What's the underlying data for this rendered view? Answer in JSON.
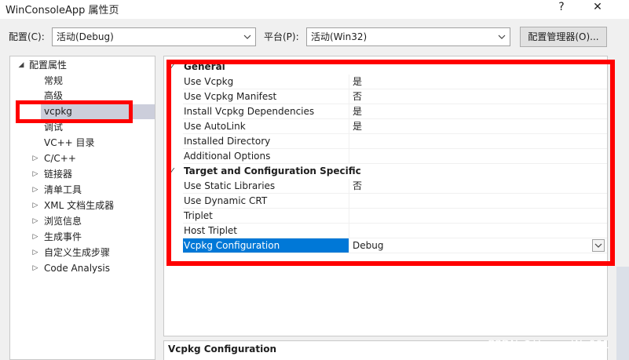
{
  "window": {
    "title": "WinConsoleApp 属性页",
    "help_label": "?",
    "close_label": "✕"
  },
  "toolbar": {
    "config_label": "配置(C):",
    "config_value": "活动(Debug)",
    "platform_label": "平台(P):",
    "platform_value": "活动(Win32)",
    "manager_button": "配置管理器(O)..."
  },
  "tree": {
    "root": "配置属性",
    "items": [
      "常规",
      "高级",
      "vcpkg",
      "调试",
      "VC++ 目录",
      "C/C++",
      "链接器",
      "清单工具",
      "XML 文档生成器",
      "浏览信息",
      "生成事件",
      "自定义生成步骤",
      "Code Analysis"
    ],
    "selected": "vcpkg"
  },
  "grid": {
    "general": {
      "title": "General",
      "rows": [
        {
          "name": "Use Vcpkg",
          "value": "是"
        },
        {
          "name": "Use Vcpkg Manifest",
          "value": "否"
        },
        {
          "name": "Install Vcpkg Dependencies",
          "value": "是"
        },
        {
          "name": "Use AutoLink",
          "value": "是"
        },
        {
          "name": "Installed Directory",
          "value": ""
        },
        {
          "name": "Additional Options",
          "value": ""
        }
      ]
    },
    "target": {
      "title": "Target and Configuration Specific",
      "rows": [
        {
          "name": "Use Static Libraries",
          "value": "否"
        },
        {
          "name": "Use Dynamic CRT",
          "value": ""
        },
        {
          "name": "Triplet",
          "value": ""
        },
        {
          "name": "Host Triplet",
          "value": ""
        },
        {
          "name": "Vcpkg Configuration",
          "value": "Debug"
        }
      ]
    },
    "selected_row": "Vcpkg Configuration"
  },
  "description": {
    "title": "Vcpkg Configuration"
  },
  "watermark": "CSDN @Henry_Wu001",
  "colors": {
    "highlight": "#ff0000",
    "selection": "#0078d7",
    "tree_selection": "#cccedb"
  }
}
